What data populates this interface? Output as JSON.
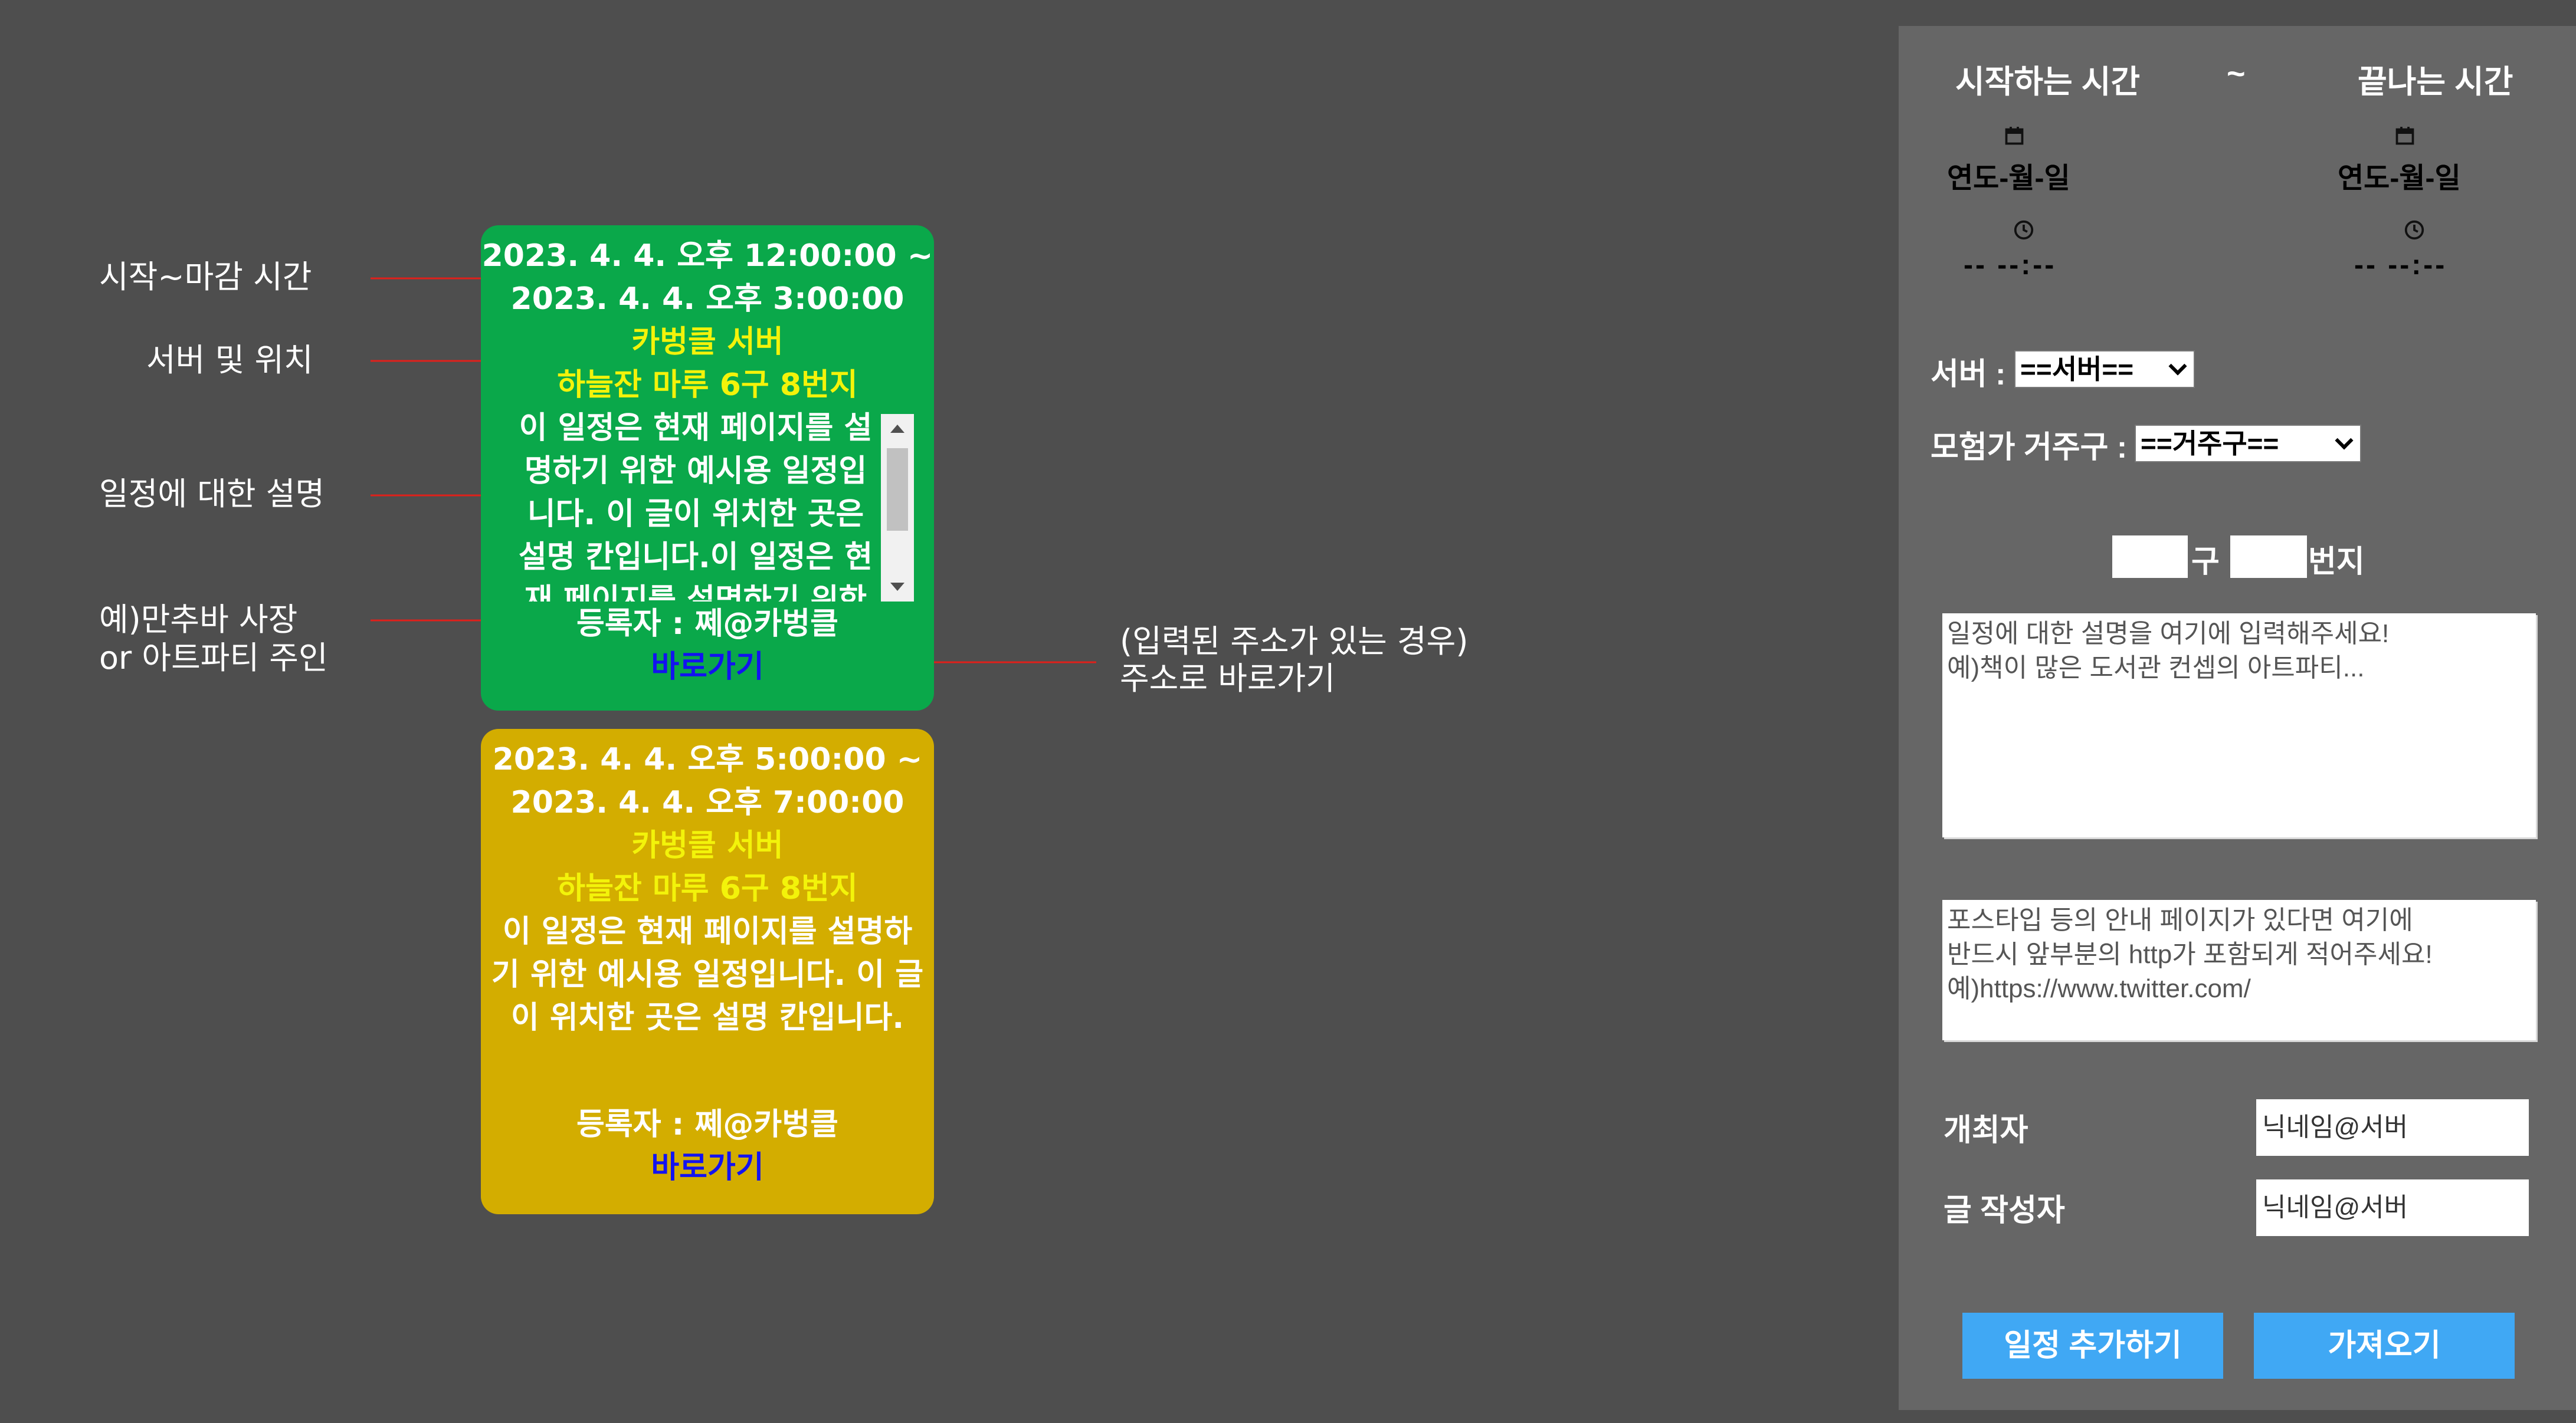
{
  "annotations": {
    "time": "시작~마감 시간",
    "server": "서버 및 위치",
    "description": "일정에 대한 설명",
    "owner_line1": "예)만추바 사장",
    "owner_line2": "or 아트파티 주인",
    "link_line1": "(입력된 주소가 있는 경우)",
    "link_line2": "주소로 바로가기",
    "arrow_color": "#e0201b"
  },
  "cards": [
    {
      "color": "#0aa84a",
      "time_start": "2023. 4. 4. 오후 12:00:00 ~",
      "time_end": "2023. 4. 4. 오후 3:00:00",
      "server": "카벙클 서버",
      "location": "하늘잔 마루 6구 8번지",
      "description": "이 일정은 현재 페이지를 설명하기 위한 예시용 일정입니다. 이 글이 위치한 곳은 설명 칸입니다.이 일정은 현재 페이지를 설명하기 위한 예시용 일정인",
      "registrant": "등록자 : 쩨@카벙클",
      "link": "바로가기"
    },
    {
      "color": "#d3ad00",
      "time_start": "2023. 4. 4. 오후 5:00:00 ~",
      "time_end": "2023. 4. 4. 오후 7:00:00",
      "server": "카벙클 서버",
      "location": "하늘잔 마루 6구 8번지",
      "description_lines": [
        "이 일정은 현재 페이지를 설명하",
        "기 위한 예시용 일정입니다. 이 글",
        "이 위치한 곳은 설명 칸입니다."
      ],
      "registrant": "등록자 : 쩨@카벙클",
      "link": "바로가기"
    }
  ],
  "panel": {
    "start_label": "시작하는 시간",
    "tilde": "~",
    "end_label": "끝나는 시간",
    "date_placeholder": "연도-월-일",
    "time_placeholder": "-- --:--",
    "calendar_icon": "calendar-icon",
    "clock_icon": "clock-icon",
    "server_label": "서버 :",
    "server_select": "==서버==",
    "residence_label": "모험가 거주구 :",
    "residence_select": "==거주구==",
    "ward_suffix": "구",
    "plot_suffix": "번지",
    "description_placeholder": "일정에 대한 설명을 여기에 입력해주세요!\n예)책이 많은 도서관 컨셉의 아트파티...",
    "url_placeholder": "포스타입 등의 안내 페이지가 있다면 여기에\n반드시 앞부분의 http가 포함되게 적어주세요!\n예)https://www.twitter.com/",
    "host_label": "개최자",
    "host_placeholder": "닉네임@서버",
    "author_label": "글 작성자",
    "author_placeholder": "닉네임@서버",
    "add_button": "일정 추가하기",
    "import_button": "가져오기",
    "button_color": "#40a8f4"
  }
}
